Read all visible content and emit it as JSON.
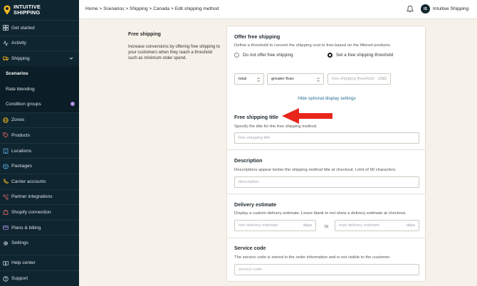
{
  "brand": {
    "line1": "INTUITIVE",
    "line2": "SHIPPING",
    "accent": "#f2b71f"
  },
  "sidebar": {
    "items": [
      {
        "label": "Get started",
        "icon": "dashboard-icon"
      },
      {
        "label": "Activity",
        "icon": "activity-icon"
      },
      {
        "label": "Shipping",
        "icon": "truck-icon"
      },
      {
        "label": "Scenarios",
        "icon": ""
      },
      {
        "label": "Rate blending",
        "icon": ""
      },
      {
        "label": "Condition groups",
        "icon": "",
        "badge": "i"
      },
      {
        "label": "Zones",
        "icon": "globe-icon"
      },
      {
        "label": "Products",
        "icon": "tag-icon"
      },
      {
        "label": "Locations",
        "icon": "building-icon"
      },
      {
        "label": "Packages",
        "icon": "package-icon"
      },
      {
        "label": "Carrier accounts",
        "icon": "phone-icon"
      },
      {
        "label": "Partner integrations",
        "icon": "integration-icon"
      },
      {
        "label": "Shopify connection",
        "icon": "bag-icon"
      },
      {
        "label": "Plans & billing",
        "icon": "card-icon"
      },
      {
        "label": "Settings",
        "icon": "gear-icon"
      }
    ],
    "bottom": [
      {
        "label": "Help center",
        "icon": "book-icon"
      },
      {
        "label": "Support",
        "icon": "help-icon"
      }
    ]
  },
  "header": {
    "breadcrumb": "Home > Scenarios > Shipping > Canada > Edit shipping method",
    "avatar_initials": "IS",
    "store_name": "Intuitive Shipping"
  },
  "section": {
    "title": "Free shipping",
    "description": "Increase conversions by offering free shipping to your customers when they reach a threshold such as minimum order spend."
  },
  "offer": {
    "title": "Offer free shipping",
    "description": "Define a threshold to convert the shipping cost to free based on the filtered products.",
    "option_none": "Do not offer free shipping",
    "option_threshold": "Set a free shipping threshold",
    "select_metric": "total",
    "select_operator": "greater than",
    "threshold_placeholder": "free shipping threshold",
    "threshold_unit": "USD",
    "toggle_link": "Hide optional display settings"
  },
  "free_title": {
    "title": "Free shipping title",
    "description": "Specify the title for the free shipping method.",
    "placeholder": "free shipping title"
  },
  "description_sec": {
    "title": "Description",
    "description": "Descriptions appear below the shipping method title at checkout. Limit of 90 characters.",
    "placeholder": "description"
  },
  "delivery": {
    "title": "Delivery estimate",
    "description": "Display a custom delivery estimate. Leave blank to not show a delivery estimate at checkout.",
    "min_placeholder": "min delivery estimate",
    "max_placeholder": "max delivery estimate",
    "unit": "days",
    "separator": "to"
  },
  "service": {
    "title": "Service code",
    "description": "The service code is stored in the order information and is not visible to the customer.",
    "placeholder": "service code"
  },
  "colors": {
    "sidebar_bg": "#0f2530",
    "link": "#2c6e93",
    "arrow": "#e8261c"
  }
}
